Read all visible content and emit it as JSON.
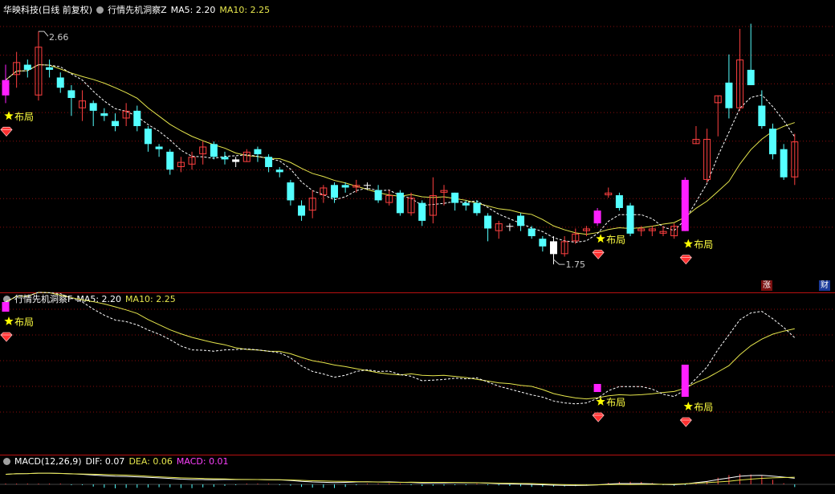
{
  "header1": {
    "stock": "华映科技(日线 前复权)",
    "indicator": "行情先机洞察Z",
    "ma5": "MA5: 2.20",
    "ma10": "MA10: 2.25"
  },
  "header2": {
    "indicator": "行情先机洞察F",
    "ma5": "MA5: 2.20",
    "ma10": "MA10: 2.25"
  },
  "header3": {
    "name": "MACD(12,26,9)",
    "dif": "DIF: 0.07",
    "dea": "DEA: 0.06",
    "macd": "MACD: 0.01"
  },
  "labels": {
    "high": "2.66",
    "low": "1.75",
    "signal": "布局",
    "tag_up": "涨",
    "tag_fin": "财"
  },
  "colors": {
    "up": "#ff4040",
    "down": "#54ffff",
    "signal_bar": "#ff20ff",
    "ma5": "#ffffff",
    "ma10": "#e6e64c",
    "grid": "#8a0d0d",
    "star": "#ffff00"
  },
  "chart_data": {
    "type": "candlestick",
    "candles": [
      [
        2.41,
        2.47,
        2.53,
        2.38,
        "signal"
      ],
      [
        2.49,
        2.54,
        2.58,
        2.44,
        "up"
      ],
      [
        2.53,
        2.51,
        2.55,
        2.48,
        "down"
      ],
      [
        2.41,
        2.6,
        2.66,
        2.39,
        "up"
      ],
      [
        2.51,
        2.52,
        2.55,
        2.48,
        "down"
      ],
      [
        2.48,
        2.44,
        2.5,
        2.42,
        "down"
      ],
      [
        2.43,
        2.4,
        2.45,
        2.33,
        "down"
      ],
      [
        2.36,
        2.39,
        2.43,
        2.31,
        "up"
      ],
      [
        2.35,
        2.38,
        2.39,
        2.29,
        "down"
      ],
      [
        2.34,
        2.33,
        2.36,
        2.31,
        "down"
      ],
      [
        2.31,
        2.29,
        2.34,
        2.27,
        "down"
      ],
      [
        2.32,
        2.35,
        2.38,
        2.29,
        "up"
      ],
      [
        2.35,
        2.29,
        2.37,
        2.27,
        "down"
      ],
      [
        2.28,
        2.22,
        2.29,
        2.19,
        "down"
      ],
      [
        2.21,
        2.2,
        2.22,
        2.17,
        "down"
      ],
      [
        2.19,
        2.12,
        2.2,
        2.1,
        "down"
      ],
      [
        2.13,
        2.15,
        2.17,
        2.11,
        "up"
      ],
      [
        2.14,
        2.17,
        2.19,
        2.12,
        "up"
      ],
      [
        2.18,
        2.21,
        2.23,
        2.14,
        "up"
      ],
      [
        2.22,
        2.17,
        2.23,
        2.16,
        "down"
      ],
      [
        2.17,
        2.16,
        2.19,
        2.14,
        "down"
      ],
      [
        2.15,
        2.16,
        2.17,
        2.13,
        "neutral"
      ],
      [
        2.15,
        2.19,
        2.2,
        2.15,
        "up"
      ],
      [
        2.2,
        2.18,
        2.21,
        2.15,
        "down"
      ],
      [
        2.17,
        2.13,
        2.18,
        2.11,
        "down"
      ],
      [
        2.12,
        2.11,
        2.13,
        2.09,
        "down"
      ],
      [
        2.07,
        2.0,
        2.08,
        1.98,
        "down"
      ],
      [
        1.98,
        1.94,
        2.0,
        1.92,
        "down"
      ],
      [
        1.96,
        2.01,
        2.04,
        1.93,
        "up"
      ],
      [
        2.02,
        2.05,
        2.06,
        1.99,
        "up"
      ],
      [
        2.06,
        2.01,
        2.07,
        1.99,
        "down"
      ],
      [
        2.05,
        2.06,
        2.07,
        2.03,
        "down"
      ],
      [
        2.05,
        2.06,
        2.08,
        2.03,
        "up"
      ],
      [
        2.06,
        2.06,
        2.07,
        2.04,
        "neutral"
      ],
      [
        2.04,
        2.0,
        2.06,
        1.99,
        "down"
      ],
      [
        1.99,
        2.02,
        2.04,
        1.98,
        "up"
      ],
      [
        2.03,
        1.95,
        2.04,
        1.94,
        "down"
      ],
      [
        1.95,
        2.01,
        2.03,
        1.94,
        "up"
      ],
      [
        1.99,
        1.92,
        2.0,
        1.9,
        "down"
      ],
      [
        1.94,
        2.02,
        2.09,
        1.91,
        "up"
      ],
      [
        2.03,
        2.04,
        2.06,
        1.98,
        "up"
      ],
      [
        2.03,
        1.99,
        2.03,
        1.96,
        "down"
      ],
      [
        1.98,
        1.99,
        2.0,
        1.96,
        "down"
      ],
      [
        1.99,
        1.95,
        2.0,
        1.94,
        "down"
      ],
      [
        1.94,
        1.89,
        1.95,
        1.84,
        "down"
      ],
      [
        1.88,
        1.91,
        1.92,
        1.85,
        "up"
      ],
      [
        1.9,
        1.9,
        1.91,
        1.88,
        "neutral"
      ],
      [
        1.94,
        1.9,
        1.95,
        1.88,
        "down"
      ],
      [
        1.89,
        1.86,
        1.9,
        1.85,
        "down"
      ],
      [
        1.85,
        1.82,
        1.86,
        1.8,
        "down"
      ],
      [
        1.84,
        1.79,
        1.86,
        1.75,
        "neutral"
      ],
      [
        1.79,
        1.84,
        1.86,
        1.78,
        "up"
      ],
      [
        1.84,
        1.87,
        1.89,
        1.83,
        "up"
      ],
      [
        1.88,
        1.89,
        1.9,
        1.86,
        "up"
      ],
      [
        1.91,
        1.96,
        1.97,
        1.9,
        "signal"
      ],
      [
        2.02,
        2.03,
        2.05,
        2.01,
        "up"
      ],
      [
        2.02,
        1.97,
        2.03,
        1.96,
        "down"
      ],
      [
        1.98,
        1.87,
        1.99,
        1.86,
        "down"
      ],
      [
        1.88,
        1.89,
        1.9,
        1.86,
        "up"
      ],
      [
        1.89,
        1.88,
        1.9,
        1.86,
        "up"
      ],
      [
        1.88,
        1.87,
        1.9,
        1.86,
        "up"
      ],
      [
        1.86,
        1.9,
        1.91,
        1.85,
        "up"
      ],
      [
        1.88,
        2.08,
        2.09,
        1.88,
        "signal"
      ],
      [
        2.22,
        2.24,
        2.29,
        2.22,
        "up"
      ],
      [
        2.08,
        2.24,
        2.28,
        2.07,
        "up"
      ],
      [
        2.38,
        2.41,
        2.41,
        2.25,
        "up"
      ],
      [
        2.46,
        2.36,
        2.57,
        2.32,
        "down"
      ],
      [
        2.36,
        2.55,
        2.67,
        2.35,
        "up"
      ],
      [
        2.51,
        2.45,
        2.69,
        2.45,
        "down"
      ],
      [
        2.37,
        2.29,
        2.43,
        2.28,
        "down"
      ],
      [
        2.28,
        2.18,
        2.3,
        2.16,
        "down"
      ],
      [
        2.2,
        2.09,
        2.22,
        2.08,
        "down"
      ],
      [
        2.09,
        2.23,
        2.26,
        2.06,
        "up"
      ]
    ],
    "signal_days": [
      0,
      54,
      62
    ],
    "price_high_label": "2.66",
    "price_low_label": "1.75",
    "macd": {
      "dif": 0.07,
      "dea": 0.06,
      "macd": 0.01
    }
  }
}
